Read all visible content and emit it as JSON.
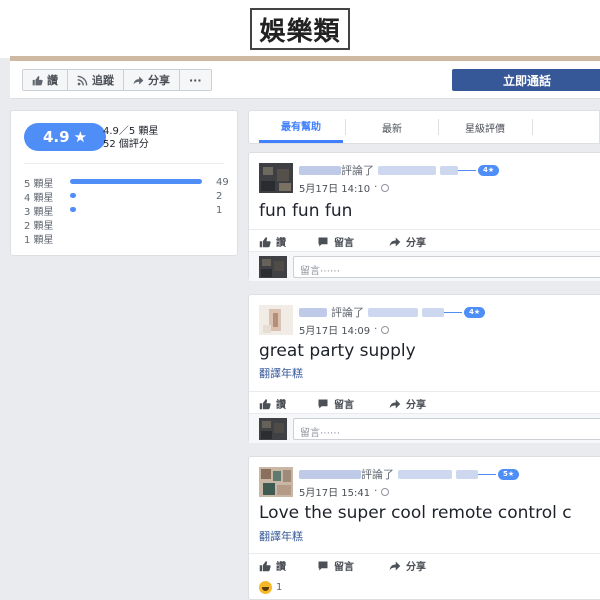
{
  "badge_title": "娛樂類",
  "action_bar": {
    "like_label": "讚",
    "follow_label": "追蹤",
    "share_label": "分享",
    "more_label": "···",
    "call_now_label": "立即通話"
  },
  "rating": {
    "score": "4.9",
    "star": "★",
    "summary": "4.9／5 顆星",
    "count": "52 個評分",
    "distribution": [
      {
        "label": "5 顆星",
        "count": "49",
        "fraction": 0.94
      },
      {
        "label": "4 顆星",
        "count": "2",
        "fraction": 0.04
      },
      {
        "label": "3 顆星",
        "count": "1",
        "fraction": 0.02
      },
      {
        "label": "2 顆星",
        "count": "",
        "fraction": 0
      },
      {
        "label": "1 顆星",
        "count": "",
        "fraction": 0
      }
    ]
  },
  "tabs": [
    "最有幫助",
    "最新",
    "星級評價"
  ],
  "review_common": {
    "reviewed_label": "評論了",
    "like_label": "讚",
    "comment_label": "留言",
    "share_label": "分享",
    "comment_placeholder": "留言⋯⋯",
    "translate_label": "翻譯年糕"
  },
  "reviews": [
    {
      "date": "5月17日 14:10",
      "stars": "4★",
      "text": "fun fun fun"
    },
    {
      "date": "5月17日 14:09",
      "stars": "4★",
      "text": "great party supply"
    },
    {
      "date": "5月17日 15:41",
      "stars": "5★",
      "text": "Love the super cool remote control c",
      "reaction_count": "1"
    }
  ],
  "colors": {
    "accent": "#4f8ef7",
    "brand_dark": "#365899",
    "page_bg": "#e9ebee"
  }
}
